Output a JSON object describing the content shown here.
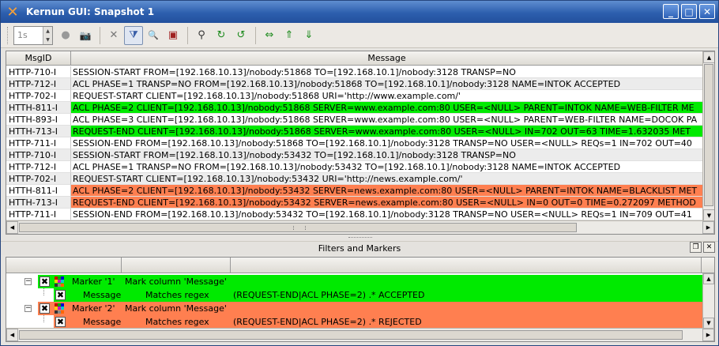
{
  "window": {
    "title": "Kernun GUI: Snapshot 1",
    "controls": [
      "_",
      "□",
      "✕"
    ]
  },
  "toolbar": {
    "interval_value": "1s",
    "buttons": [
      {
        "name": "play-icon",
        "glyph": "●"
      },
      {
        "name": "camera-icon",
        "glyph": "📷"
      },
      {
        "name": "clear-filter-icon",
        "glyph": "✕"
      },
      {
        "name": "filter-icon",
        "glyph": "⧩"
      },
      {
        "name": "search-icon",
        "glyph": "🔍"
      },
      {
        "name": "bookmark-icon",
        "glyph": "▣"
      },
      {
        "name": "zoom-icon",
        "glyph": "⚲"
      },
      {
        "name": "find-next-icon",
        "glyph": "↻"
      },
      {
        "name": "find-prev-icon",
        "glyph": "↺"
      },
      {
        "name": "expand-width-icon",
        "glyph": "⇔"
      },
      {
        "name": "scroll-up-icon",
        "glyph": "⇑"
      },
      {
        "name": "scroll-down-icon",
        "glyph": "⇓"
      }
    ]
  },
  "table": {
    "columns": [
      "MsgID",
      "Message"
    ],
    "rows": [
      {
        "id": "HTTP-710-I",
        "msg": "SESSION-START FROM=[192.168.10.13]/nobody:51868 TO=[192.168.10.1]/nobody:3128 TRANSP=NO",
        "mark": "none"
      },
      {
        "id": "HTTP-712-I",
        "msg": "ACL PHASE=1 TRANSP=NO FROM=[192.168.10.13]/nobody:51868 TO=[192.168.10.1]/nobody:3128 NAME=INTOK ACCEPTED",
        "mark": "none"
      },
      {
        "id": "HTTP-702-I",
        "msg": "REQUEST-START CLIENT=[192.168.10.13]/nobody:51868 URI='http://www.example.com/'",
        "mark": "none"
      },
      {
        "id": "HTTH-811-I",
        "msg": "ACL PHASE=2 CLIENT=[192.168.10.13]/nobody:51868 SERVER=www.example.com:80 USER=<NULL> PARENT=INTOK NAME=WEB-FILTER ME",
        "mark": "green"
      },
      {
        "id": "HTTH-893-I",
        "msg": "ACL PHASE=3 CLIENT=[192.168.10.13]/nobody:51868 SERVER=www.example.com:80 USER=<NULL> PARENT=WEB-FILTER NAME=DOCOK PA",
        "mark": "none"
      },
      {
        "id": "HTTH-713-I",
        "msg": "REQUEST-END CLIENT=[192.168.10.13]/nobody:51868 SERVER=www.example.com:80 USER=<NULL> IN=702 OUT=63 TIME=1.632035 MET",
        "mark": "green"
      },
      {
        "id": "HTTP-711-I",
        "msg": "SESSION-END FROM=[192.168.10.13]/nobody:51868 TO=[192.168.10.1]/nobody:3128 TRANSP=NO USER=<NULL> REQs=1 IN=702 OUT=40",
        "mark": "none"
      },
      {
        "id": "HTTP-710-I",
        "msg": "SESSION-START FROM=[192.168.10.13]/nobody:53432 TO=[192.168.10.1]/nobody:3128 TRANSP=NO",
        "mark": "none"
      },
      {
        "id": "HTTP-712-I",
        "msg": "ACL PHASE=1 TRANSP=NO FROM=[192.168.10.13]/nobody:53432 TO=[192.168.10.1]/nobody:3128 NAME=INTOK ACCEPTED",
        "mark": "none"
      },
      {
        "id": "HTTP-702-I",
        "msg": "REQUEST-START CLIENT=[192.168.10.13]/nobody:53432 URI='http://news.example.com/'",
        "mark": "none"
      },
      {
        "id": "HTTH-811-I",
        "msg": "ACL PHASE=2 CLIENT=[192.168.10.13]/nobody:53432 SERVER=news.example.com:80 USER=<NULL> PARENT=INTOK NAME=BLACKLIST MET",
        "mark": "orange"
      },
      {
        "id": "HTTH-713-I",
        "msg": "REQUEST-END CLIENT=[192.168.10.13]/nobody:53432 SERVER=news.example.com:80 USER=<NULL> IN=0 OUT=0 TIME=0.272097 METHOD",
        "mark": "orange"
      },
      {
        "id": "HTTP-711-I",
        "msg": "SESSION-END FROM=[192.168.10.13]/nobody:53432 TO=[192.168.10.1]/nobody:3128 TRANSP=NO USER=<NULL> REQs=1 IN=709 OUT=41",
        "mark": "none"
      }
    ]
  },
  "filters_panel": {
    "title": "Filters and Markers",
    "markers": [
      {
        "label": "Marker '1'",
        "action": "Mark column 'Message'",
        "column": "Message",
        "condition": "Matches regex",
        "pattern": "(REQUEST-END|ACL PHASE=2) .* ACCEPTED",
        "color": "#00ea00"
      },
      {
        "label": "Marker '2'",
        "action": "Mark column 'Message'",
        "column": "Message",
        "condition": "Matches regex",
        "pattern": "(REQUEST-END|ACL PHASE=2) .* REJECTED",
        "color": "#ff7f50"
      }
    ]
  },
  "colors": {
    "marker_green": "#00ea00",
    "marker_orange": "#ff7f50",
    "titlebar": "#2d5fae"
  }
}
